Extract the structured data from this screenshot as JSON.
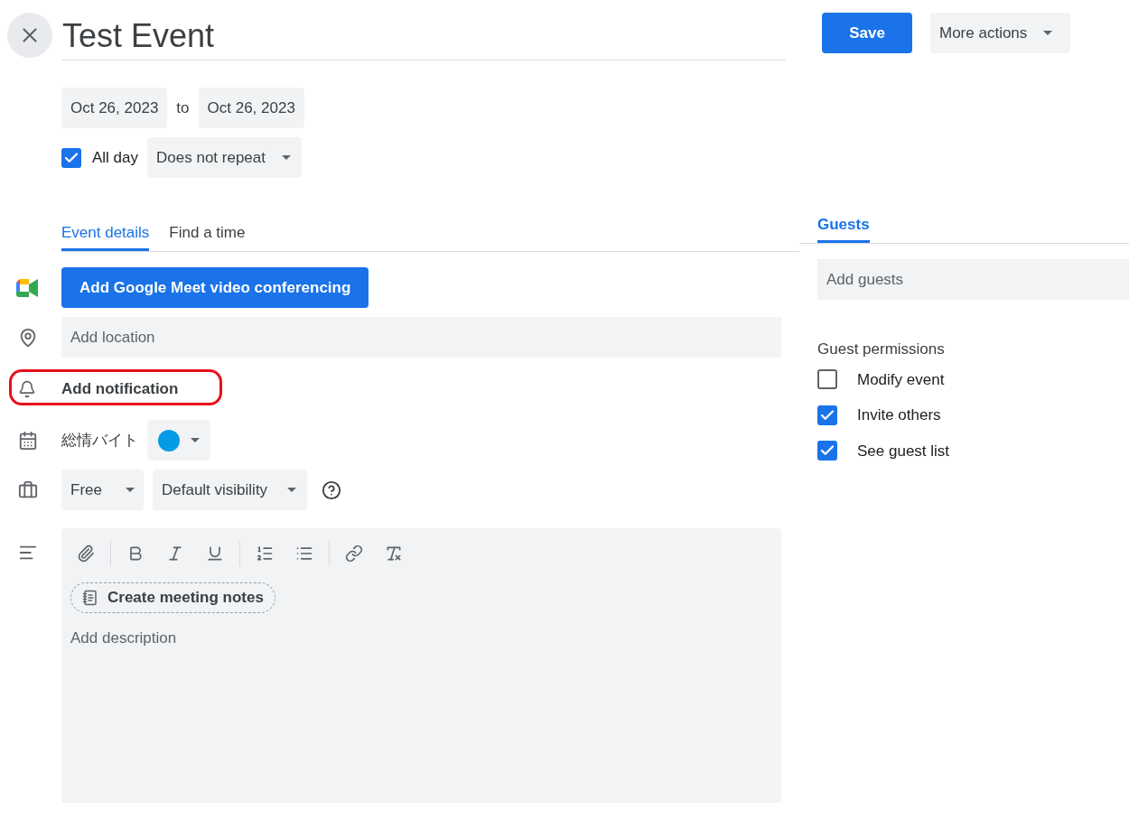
{
  "title": "Test Event",
  "header": {
    "save": "Save",
    "more_actions": "More actions"
  },
  "dates": {
    "start": "Oct 26, 2023",
    "separator": "to",
    "end": "Oct 26, 2023"
  },
  "all_day": {
    "label": "All day",
    "checked": true
  },
  "repeat": "Does not repeat",
  "tabs": [
    {
      "label": "Event details",
      "selected": true
    },
    {
      "label": "Find a time",
      "selected": false
    }
  ],
  "meet_button": "Add Google Meet video conferencing",
  "location": {
    "placeholder": "Add location"
  },
  "notification": {
    "label": "Add notification",
    "highlighted": true
  },
  "calendar": {
    "name": "総情バイト",
    "color": "#039be5"
  },
  "availability": "Free",
  "visibility": "Default visibility",
  "description": {
    "meeting_notes": "Create meeting notes",
    "placeholder": "Add description"
  },
  "guests_tab": {
    "label": "Guests",
    "selected": true
  },
  "guests": {
    "placeholder": "Add guests"
  },
  "permissions": {
    "title": "Guest permissions",
    "items": [
      {
        "label": "Modify event",
        "checked": false
      },
      {
        "label": "Invite others",
        "checked": true
      },
      {
        "label": "See guest list",
        "checked": true
      }
    ]
  }
}
